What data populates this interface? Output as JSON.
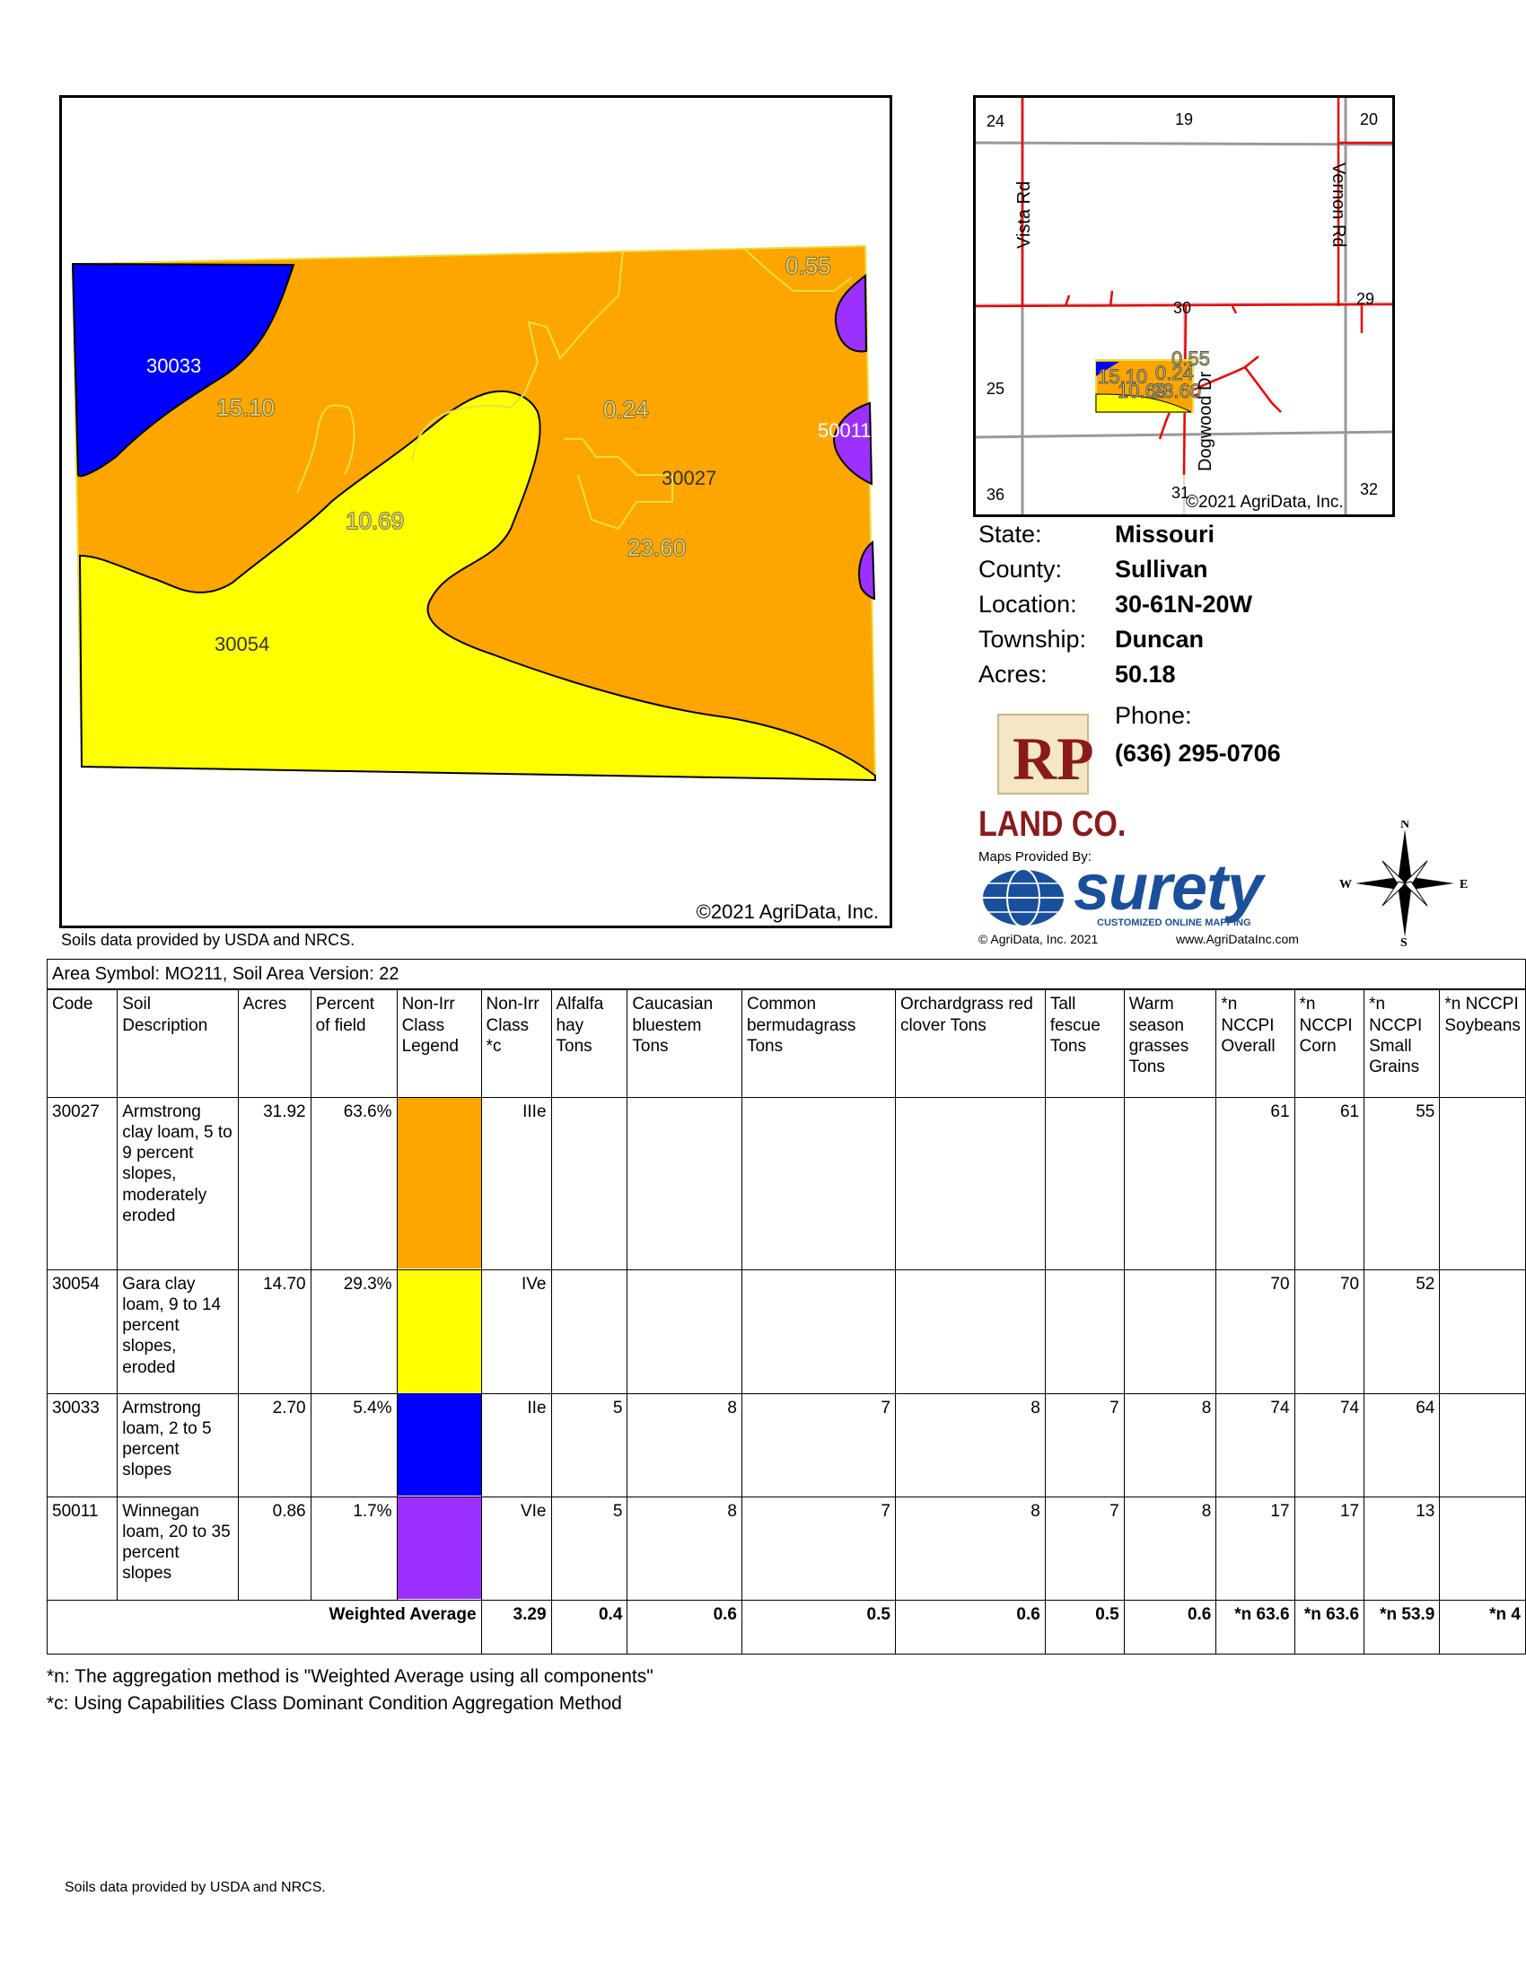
{
  "soil_map": {
    "labels": {
      "code_30033": "30033",
      "code_30054": "30054",
      "code_30027": "30027",
      "code_50011": "50011",
      "acres_15": "15.10",
      "acres_10": "10.69",
      "acres_024": "0.24",
      "acres_2360": "23.60",
      "acres_055": "0.55"
    },
    "copyright": "©2021 AgriData, Inc.",
    "credit": "Soils data provided by USDA and NRCS."
  },
  "location_map": {
    "sections": {
      "s24": "24",
      "s19": "19",
      "s20": "20",
      "s25": "25",
      "s30": "30",
      "s29": "29",
      "s36": "36",
      "s31": "31",
      "s32": "32"
    },
    "roads": {
      "vista": "Vista Rd",
      "vernon": "Vernon Rd",
      "dogwood": "Dogwood Dr"
    },
    "overlay_labels": {
      "a": "15.10",
      "b": "0.24",
      "c": "0.55",
      "d": "10.69",
      "e": "23.60"
    },
    "copyright": "©2021 AgriData, Inc."
  },
  "info": {
    "state_label": "State:",
    "state": "Missouri",
    "county_label": "County:",
    "county": "Sullivan",
    "location_label": "Location:",
    "location": "30-61N-20W",
    "township_label": "Township:",
    "township": "Duncan",
    "acres_label": "Acres:",
    "acres": "50.18",
    "phone_label": "Phone:",
    "phone": "(636) 295-0706"
  },
  "branding": {
    "rp_text": "RP",
    "land_co": "LAND CO.",
    "maps_provided_by": "Maps Provided By:",
    "surety": "surety",
    "surety_tagline": "CUSTOMIZED ONLINE MAPPING",
    "agridata_copy": "© AgriData, Inc. 2021",
    "agridata_url": "www.AgriDataInc.com",
    "compass": {
      "n": "N",
      "s": "S",
      "e": "E",
      "w": "W"
    }
  },
  "table": {
    "area_symbol": "Area Symbol: MO211, Soil Area Version: 22",
    "headers": [
      "Code",
      "Soil Description",
      "Acres",
      "Percent of field",
      "Non-Irr Class Legend",
      "Non-Irr Class *c",
      "Alfalfa hay Tons",
      "Caucasian bluestem Tons",
      "Common bermudagrass Tons",
      "Orchardgrass red clover Tons",
      "Tall fescue Tons",
      "Warm season grasses Tons",
      "*n NCCPI Overall",
      "*n NCCPI Corn",
      "*n NCCPI Small Grains",
      "*n NCCPI Soybeans"
    ],
    "rows": [
      {
        "code": "30027",
        "desc": "Armstrong clay loam, 5 to 9 percent slopes, moderately eroded",
        "acres": "31.92",
        "pct": "63.6%",
        "color": "#ffa500",
        "cls": "IIIe",
        "alfalfa": "",
        "bluestem": "",
        "bermuda": "",
        "orchard": "",
        "fescue": "",
        "warm": "",
        "overall": "61",
        "corn": "61",
        "small": "55",
        "soy": ""
      },
      {
        "code": "30054",
        "desc": "Gara clay loam, 9 to 14 percent slopes, eroded",
        "acres": "14.70",
        "pct": "29.3%",
        "color": "#ffff00",
        "cls": "IVe",
        "alfalfa": "",
        "bluestem": "",
        "bermuda": "",
        "orchard": "",
        "fescue": "",
        "warm": "",
        "overall": "70",
        "corn": "70",
        "small": "52",
        "soy": ""
      },
      {
        "code": "30033",
        "desc": "Armstrong loam, 2 to 5 percent slopes",
        "acres": "2.70",
        "pct": "5.4%",
        "color": "#0000ff",
        "cls": "IIe",
        "alfalfa": "5",
        "bluestem": "8",
        "bermuda": "7",
        "orchard": "8",
        "fescue": "7",
        "warm": "8",
        "overall": "74",
        "corn": "74",
        "small": "64",
        "soy": ""
      },
      {
        "code": "50011",
        "desc": "Winnegan loam, 20 to 35 percent slopes",
        "acres": "0.86",
        "pct": "1.7%",
        "color": "#9b30ff",
        "cls": "VIe",
        "alfalfa": "5",
        "bluestem": "8",
        "bermuda": "7",
        "orchard": "8",
        "fescue": "7",
        "warm": "8",
        "overall": "17",
        "corn": "17",
        "small": "13",
        "soy": ""
      }
    ],
    "weighted": {
      "label": "Weighted Average",
      "cls": "3.29",
      "alfalfa": "0.4",
      "bluestem": "0.6",
      "bermuda": "0.5",
      "orchard": "0.6",
      "fescue": "0.5",
      "warm": "0.6",
      "overall": "*n 63.6",
      "corn": "*n 63.6",
      "small": "*n 53.9",
      "soy": "*n 4"
    }
  },
  "footnotes": {
    "n": "*n: The aggregation method is \"Weighted Average using all components\"",
    "c": "*c:  Using Capabilities Class Dominant Condition Aggregation Method",
    "credit": "Soils data provided by USDA and NRCS."
  }
}
